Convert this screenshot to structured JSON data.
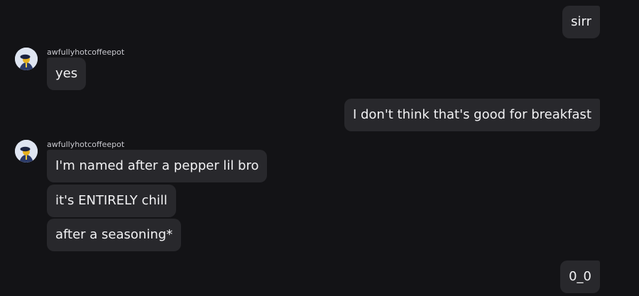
{
  "messages": {
    "m1": {
      "text": "sirr",
      "direction": "outgoing"
    },
    "g1": {
      "username": "awfullyhotcoffeepot",
      "avatar_icon": "user-avatar-icon",
      "m2": {
        "text": "yes",
        "direction": "incoming"
      }
    },
    "m3": {
      "text": "I don't think that's good for breakfast",
      "direction": "outgoing"
    },
    "g2": {
      "username": "awfullyhotcoffeepot",
      "avatar_icon": "user-avatar-icon",
      "m4": {
        "text": "I'm named after a pepper lil bro",
        "direction": "incoming"
      },
      "m5": {
        "text": "it's ENTIRELY chill",
        "direction": "incoming"
      },
      "m6": {
        "text": "after a seasoning*",
        "direction": "incoming"
      }
    },
    "m7": {
      "text": "0_0",
      "direction": "outgoing"
    }
  },
  "colors": {
    "background": "#131316",
    "bubble": "#28282c",
    "text": "#f2f2f4",
    "username": "#c9c9cf"
  }
}
